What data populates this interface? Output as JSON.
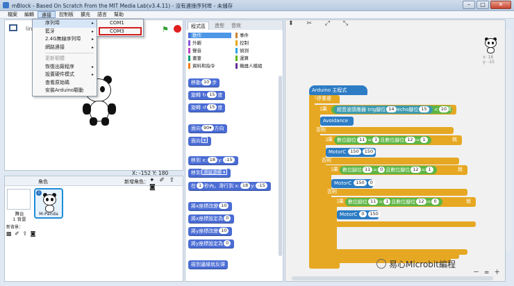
{
  "window": {
    "title": "mBlock - Based On Scratch From the MIT Media Lab(v3.4.11) - 沒有連接序列埠 - 未儲存",
    "min": "–",
    "max": "□",
    "close": "✕"
  },
  "menubar": [
    "檔案",
    "編輯",
    "連接",
    "控制板",
    "擴充",
    "語言",
    "幫助"
  ],
  "stage": {
    "label": "lin",
    "coords": "X: -152  Y: 180"
  },
  "connect_menu": {
    "items": [
      {
        "label": "序列埠",
        "arrow": "▸"
      },
      {
        "label": "藍牙",
        "arrow": "▸"
      },
      {
        "label": "2.4G無線序列埠",
        "arrow": "▸"
      },
      {
        "label": "網路連接",
        "arrow": "▸"
      },
      {
        "label": "更新韌體"
      },
      {
        "label": "恢復出廠程序",
        "arrow": "▸"
      },
      {
        "label": "設置硬件模式",
        "arrow": "▸"
      },
      {
        "label": "查看原始碼"
      },
      {
        "label": "安裝Arduino驅動"
      }
    ]
  },
  "serial_submenu": [
    "COM1",
    "COM3"
  ],
  "sprites": {
    "header_label": "角色",
    "new_sprite_label": "新增角色：",
    "new_sprite_tools": "✦ ✐ ⇪ ◙",
    "stage_caption": "舞台\n1 背景",
    "new_bg_label": "新背景：",
    "new_bg_tools": "▩ ✐ ⇪ ◙",
    "info": "i",
    "sprite_name": "M-Panda"
  },
  "palette": {
    "tabs": [
      "程式區",
      "造型",
      "音效"
    ],
    "categories": [
      {
        "name": "動作",
        "color": "#4a6cd4"
      },
      {
        "name": "事件",
        "color": "#c88330"
      },
      {
        "name": "外觀",
        "color": "#8a55d7"
      },
      {
        "name": "控制",
        "color": "#e1a91a"
      },
      {
        "name": "聲音",
        "color": "#bb42c3"
      },
      {
        "name": "偵測",
        "color": "#2ca5e2"
      },
      {
        "name": "畫筆",
        "color": "#0e9a6c"
      },
      {
        "name": "運算",
        "color": "#5cb712"
      },
      {
        "name": "資料和指令",
        "color": "#ee7d16"
      },
      {
        "name": "機器人模組",
        "color": "#632d99"
      }
    ],
    "blocks": [
      {
        "t": "移動",
        "s": "10",
        "t2": "步"
      },
      {
        "t": "旋轉 ↻",
        "s": "15",
        "t2": "度"
      },
      {
        "t": "旋轉 ↺",
        "s": "15",
        "t2": "度"
      },
      {
        "t": "面向",
        "s": "90▾",
        "t2": "方向"
      },
      {
        "t": "面向",
        "d": "▾",
        "t2": ""
      },
      {
        "t": "移到 x:",
        "s": "18",
        "t2": "y:",
        "s2": "-15"
      },
      {
        "t": "移到",
        "d": "滑鼠游標 ▾",
        "t2": ""
      },
      {
        "t": "在",
        "s": "1",
        "t2": "秒內，滑行到 x:",
        "s2": "18",
        "t3": "y:",
        "s3": "-15"
      },
      {
        "t": "將x座標改變",
        "s": "10",
        "t2": ""
      },
      {
        "t": "將x座標設定為",
        "s": "0",
        "t2": ""
      },
      {
        "t": "將y座標改變",
        "s": "10",
        "t2": ""
      },
      {
        "t": "將y座標設定為",
        "s": "0",
        "t2": ""
      },
      {
        "t": "碰到邊緣就反彈",
        "t2": ""
      }
    ]
  },
  "scripts": {
    "tools": "⬍ ✂ ⤢ ⤡",
    "sprite_corner": "x: 18\ny: -15",
    "zoom": "－ = ＋",
    "hat": "Arduino 主程式",
    "forever": "不停重複",
    "if1": {
      "kw": "如果",
      "text": "超音波感應器 trig腳位",
      "a": "14",
      "text2": "echo腳位",
      "b": "15",
      "op": "<",
      "c": "10",
      "end": "就"
    },
    "avoidance": "Avoidance",
    "else1": "否則",
    "if2": {
      "kw": "如果",
      "p1": "數位腳位",
      "a": "11",
      "eq": "=",
      "v1": "1",
      "and": "且",
      "p2": "數位腳位",
      "b": "12",
      "v2": "1",
      "end": "就"
    },
    "motor1": {
      "name": "MotorC",
      "a": "150",
      "b": "150"
    },
    "else2": "否則",
    "if3": {
      "kw": "如果",
      "p1": "數位腳位",
      "a": "11",
      "eq": "=",
      "v1": "0",
      "and": "且",
      "p2": "數位腳位",
      "b": "12",
      "v2": "1",
      "end": "就"
    },
    "motor2": {
      "name": "MotorC",
      "a": "150",
      "b": "0"
    },
    "else3": "否則",
    "if4": {
      "kw": "如果",
      "p1": "數位腳位",
      "a": "11",
      "eq": "=",
      "v1": "1",
      "and": "且",
      "p2": "數位腳位",
      "b": "12",
      "v2": "0",
      "end": "就"
    },
    "motor3": {
      "name": "MotorC",
      "a": "0",
      "b": "150"
    }
  },
  "watermark": "易心Microbit編程"
}
